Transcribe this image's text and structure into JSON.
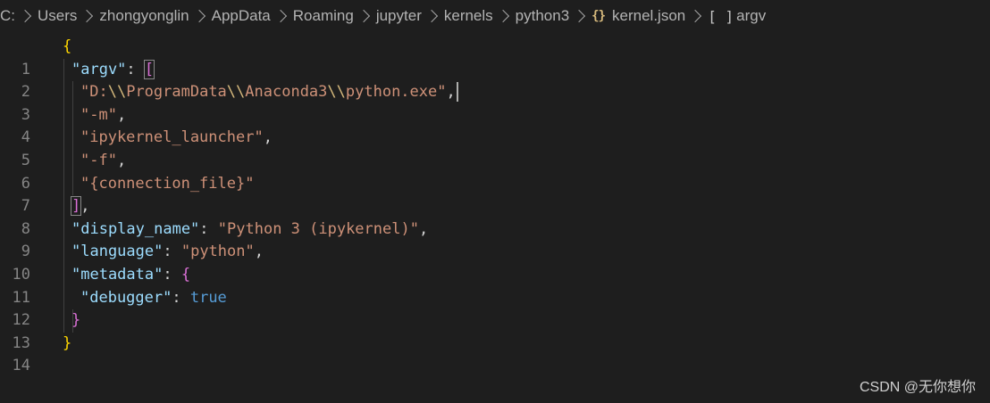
{
  "breadcrumb": {
    "items": [
      "C:",
      "Users",
      "zhongyonglin",
      "AppData",
      "Roaming",
      "jupyter",
      "kernels",
      "python3"
    ],
    "file_icon": "{}",
    "file_name": "kernel.json",
    "symbol_icon": "[ ]",
    "symbol_name": "argv"
  },
  "editor": {
    "line_numbers": [
      "1",
      "2",
      "3",
      "4",
      "5",
      "6",
      "7",
      "8",
      "9",
      "10",
      "11",
      "12",
      "13",
      "14"
    ],
    "tokens": {
      "l1_open": "{",
      "l2_key": "\"argv\"",
      "l2_colon": ": ",
      "l2_open": "[",
      "l3_q1": "\"D:",
      "l3_e1": "\\\\",
      "l3_s1": "ProgramData",
      "l3_e2": "\\\\",
      "l3_s2": "Anaconda3",
      "l3_e3": "\\\\",
      "l3_s3": "python.exe\"",
      "l3_comma": ",",
      "l4_str": "\"-m\"",
      "l4_comma": ",",
      "l5_str": "\"ipykernel_launcher\"",
      "l5_comma": ",",
      "l6_str": "\"-f\"",
      "l6_comma": ",",
      "l7_str": "\"{connection_file}\"",
      "l8_close": "]",
      "l8_comma": ",",
      "l9_key": "\"display_name\"",
      "l9_colon": ": ",
      "l9_str": "\"Python 3 (ipykernel)\"",
      "l9_comma": ",",
      "l10_key": "\"language\"",
      "l10_colon": ": ",
      "l10_str": "\"python\"",
      "l10_comma": ",",
      "l11_key": "\"metadata\"",
      "l11_colon": ": ",
      "l11_open": "{",
      "l12_key": "\"debugger\"",
      "l12_colon": ": ",
      "l12_bool": "true",
      "l13_close": "}",
      "l14_close": "}"
    }
  },
  "watermark": "CSDN @无你想你",
  "colors": {
    "background": "#1e1e1e",
    "key": "#9cdcfe",
    "string": "#ce9178",
    "escape": "#d7ba7d",
    "bracket_level1": "#ffd700",
    "bracket_level2": "#da70d6",
    "boolean": "#569cd6"
  }
}
